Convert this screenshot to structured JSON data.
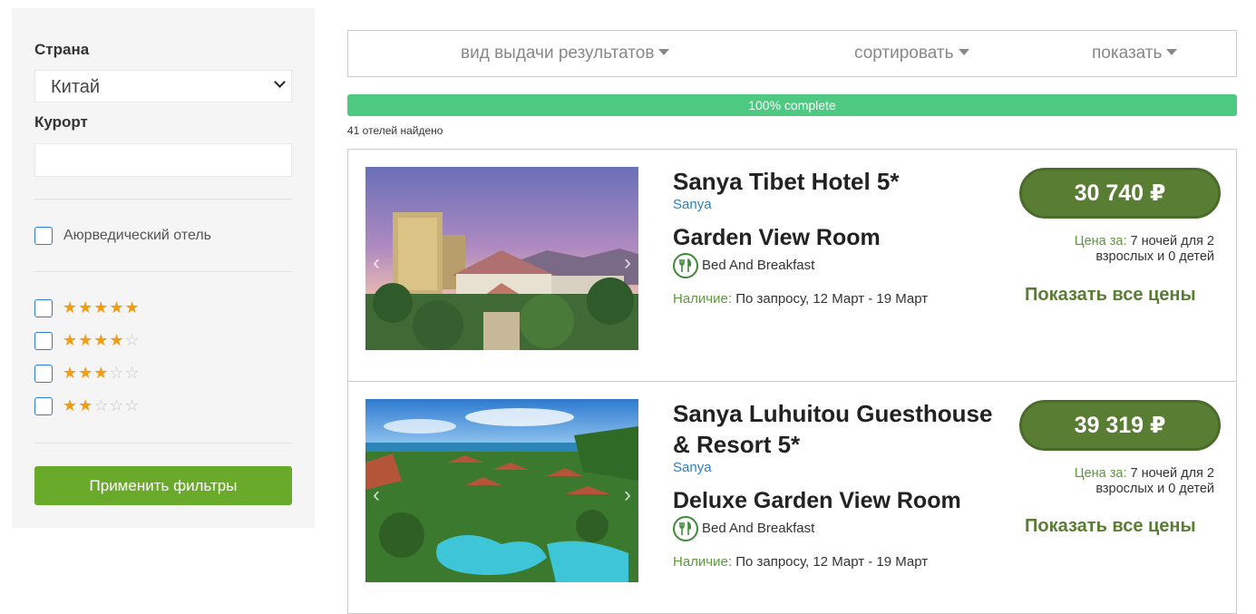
{
  "sidebar": {
    "country_label": "Страна",
    "country_value": "Китай",
    "resort_label": "Курорт",
    "resort_value": "",
    "ayurveda_label": "Аюрведический отель",
    "star_filters": [
      {
        "stars": 5,
        "checked": false
      },
      {
        "stars": 4,
        "checked": false
      },
      {
        "stars": 3,
        "checked": false
      },
      {
        "stars": 2,
        "checked": false
      }
    ],
    "apply_label": "Применить фильтры"
  },
  "toolbar": {
    "view_label": "вид выдачи результатов",
    "sort_label": "сортировать",
    "show_label": "показать"
  },
  "progress": {
    "label": "100% complete",
    "value": 1.0
  },
  "found_text": "41 отелей найдено",
  "colors": {
    "accent_green": "#6aaa2a",
    "price_green": "#5a7d34",
    "progress_green": "#4dc982",
    "link_blue": "#2b7fc2",
    "star_orange": "#f39c12"
  },
  "hotels": [
    {
      "name": "Sanya Tibet Hotel 5*",
      "city": "Sanya",
      "room": "Garden View Room",
      "meal": "Bed And Breakfast",
      "meal_icon": "fork-knife-icon",
      "availability_key": "Наличие:",
      "availability_value": "По запросу, 12 Март - 19 Март",
      "price": "30 740 ₽",
      "price_for_key": "Цена за:",
      "price_for_value": "7 ночей для 2 взрослых и 0 детей",
      "show_prices": "Показать все цены"
    },
    {
      "name": "Sanya Luhuitou Guesthouse & Resort 5*",
      "city": "Sanya",
      "room": "Deluxe Garden View Room",
      "meal": "Bed And Breakfast",
      "meal_icon": "fork-knife-icon",
      "availability_key": "Наличие:",
      "availability_value": "По запросу, 12 Март - 19 Март",
      "price": "39 319 ₽",
      "price_for_key": "Цена за:",
      "price_for_value": "7 ночей для 2 взрослых и 0 детей",
      "show_prices": "Показать все цены"
    }
  ]
}
